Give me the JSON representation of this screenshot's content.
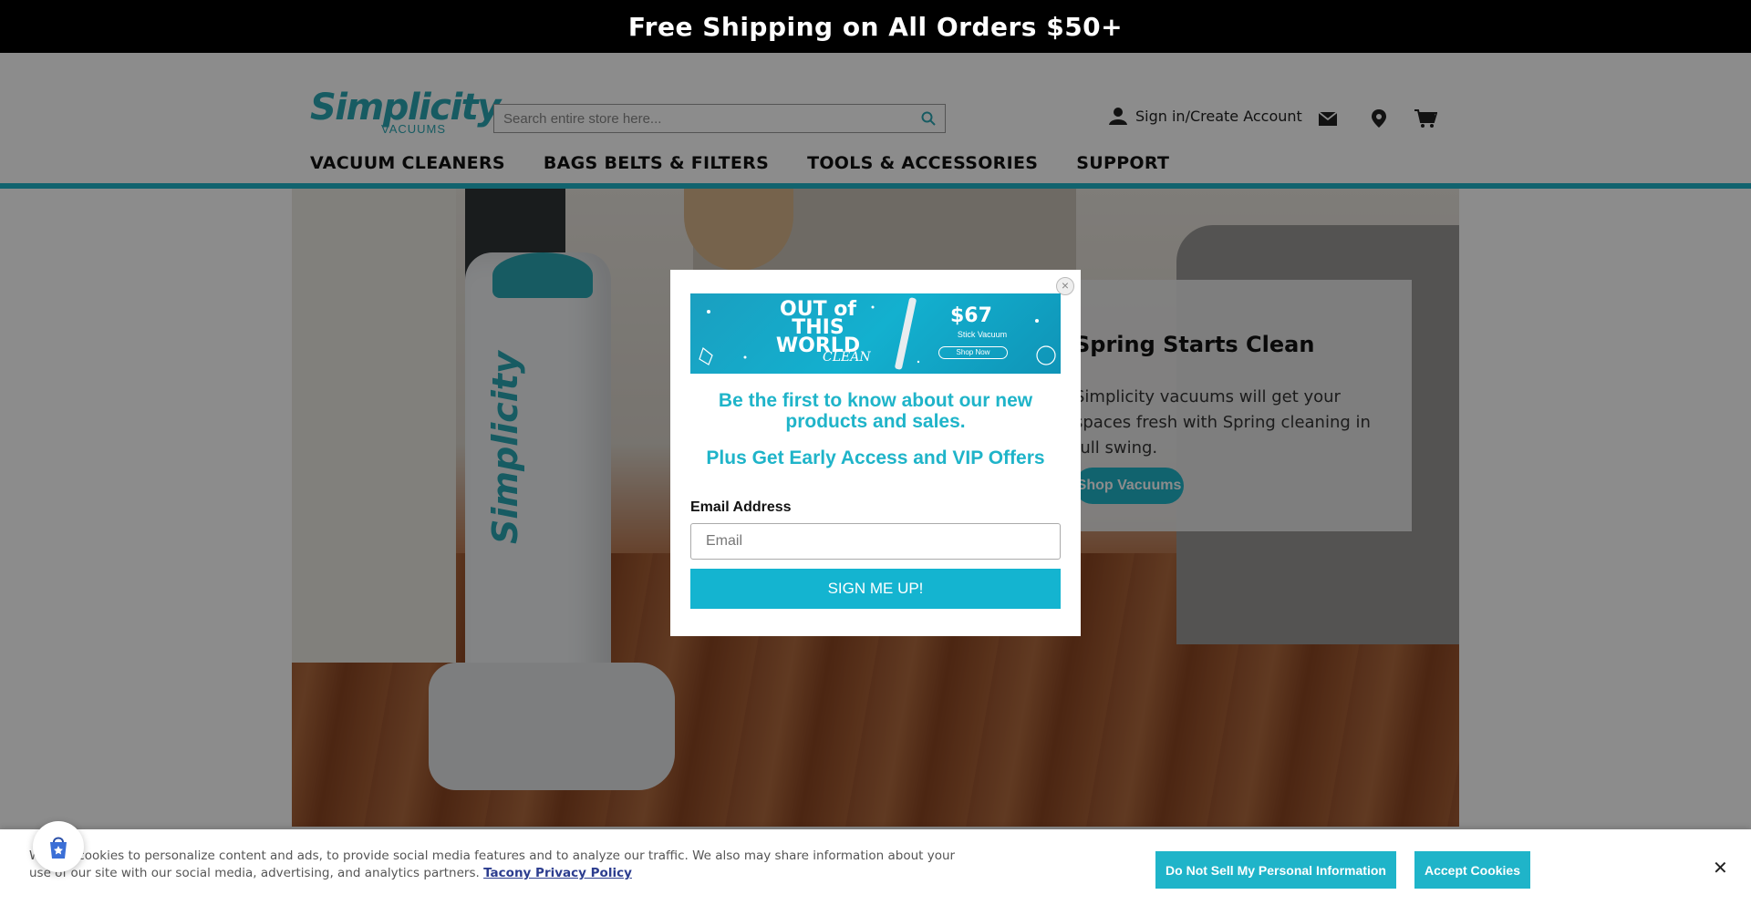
{
  "promo_bar": {
    "text": "Free Shipping on All Orders $50+"
  },
  "header": {
    "logo_main": "Simplicity",
    "logo_sub": "VACUUMS",
    "search_placeholder": "Search entire store here...",
    "account_label": "Sign in/Create Account",
    "icons": [
      "search-icon",
      "user-icon",
      "mail-icon",
      "location-pin-icon",
      "cart-icon"
    ]
  },
  "nav": {
    "items": [
      {
        "label": "VACUUM CLEANERS"
      },
      {
        "label": "BAGS BELTS & FILTERS"
      },
      {
        "label": "TOOLS & ACCESSORIES"
      },
      {
        "label": "SUPPORT"
      }
    ]
  },
  "hero": {
    "vacuum_brand": "Simplicity",
    "card_title": "Spring Starts Clean",
    "card_text": "Simplicity vacuums will get your spaces fresh with Spring cleaning in full swing.",
    "card_button": "Shop Vacuums"
  },
  "modal": {
    "banner": {
      "title": "OUT of THIS WORLD",
      "script": "CLEAN",
      "price": "$67",
      "subtitle": "Stick Vacuum",
      "shop_label": "Shop Now"
    },
    "heading1": "Be the first to know about our new products and sales.",
    "heading2": "Plus Get Early Access and VIP Offers",
    "email_label": "Email Address",
    "email_placeholder": "Email",
    "submit_label": "SIGN ME UP!",
    "close_label": "×"
  },
  "cookie_bar": {
    "text": "We use cookies to personalize content and ads, to provide social media features and to analyze our traffic. We also may share information about your use of our site with our social media, advertising, and analytics partners.",
    "link_text": "Tacony Privacy Policy",
    "dns_button": "Do Not Sell My Personal Information",
    "accept_button": "Accept Cookies",
    "close_label": "✕"
  },
  "colors": {
    "accent": "#1fb4c9",
    "brand": "#2aa7b3",
    "promo_bar_bg": "#000000",
    "privacy_link": "#2c3d8f"
  }
}
